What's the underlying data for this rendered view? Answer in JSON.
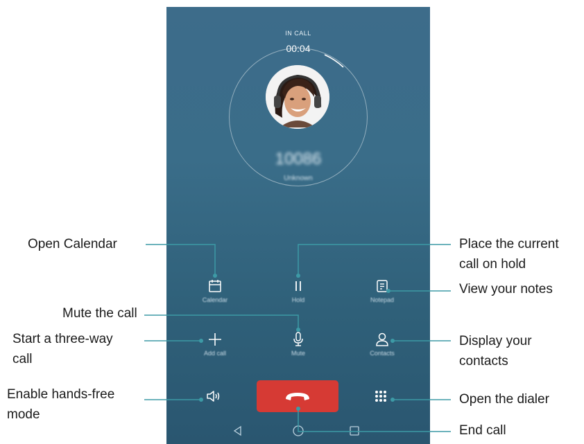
{
  "call": {
    "status": "IN CALL",
    "duration": "00:04",
    "number": "10086",
    "caller_state": "Unknown"
  },
  "controls": {
    "calendar": "Calendar",
    "hold": "Hold",
    "notepad": "Notepad",
    "add_call": "Add call",
    "mute": "Mute",
    "contacts": "Contacts"
  },
  "annotations": {
    "open_calendar": "Open Calendar",
    "hold_line1": "Place the current",
    "hold_line2": "call on hold",
    "view_notes": "View your notes",
    "mute": "Mute the call",
    "three_way_line1": "Start a three-way",
    "three_way_line2": "call",
    "contacts_line1": "Display your",
    "contacts_line2": "contacts",
    "handsfree_line1": "Enable hands-free",
    "handsfree_line2": "mode",
    "dialer": "Open the dialer",
    "end_call": "End call"
  },
  "colors": {
    "end_call_button": "#d63a34",
    "screen_background": "#3a6d89"
  },
  "icons": [
    "calendar-icon",
    "hold-icon",
    "notepad-icon",
    "add-icon",
    "microphone-icon",
    "contact-icon",
    "speaker-icon",
    "phone-hangup-icon",
    "dialpad-icon",
    "back-icon",
    "home-icon",
    "recents-icon"
  ]
}
